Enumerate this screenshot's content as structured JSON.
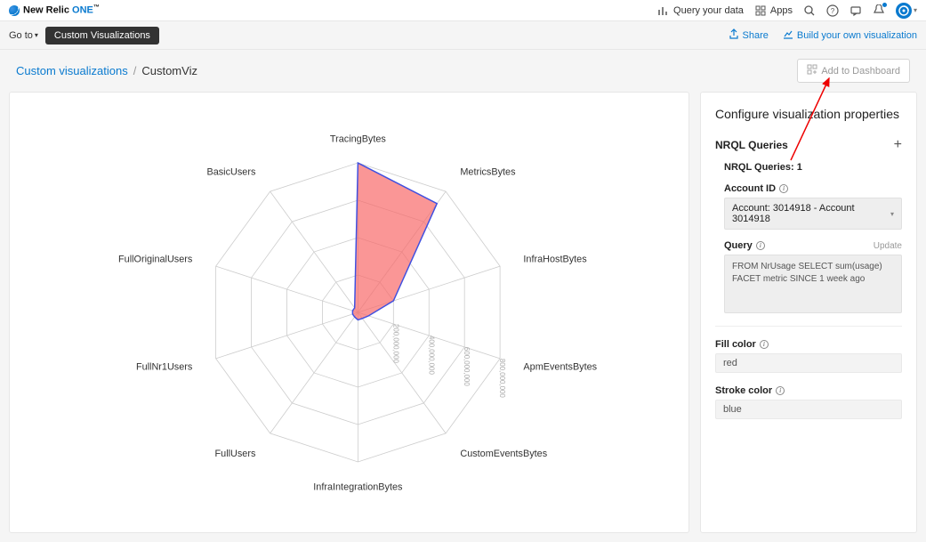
{
  "header": {
    "brand_prefix": "New Relic ",
    "brand_one": "ONE",
    "brand_tm": "™",
    "query_link": "Query your data",
    "apps_link": "Apps"
  },
  "subbar": {
    "goto": "Go to",
    "pill": "Custom Visualizations",
    "share": "Share",
    "build": "Build your own visualization"
  },
  "breadcrumb": {
    "link": "Custom visualizations",
    "sep": "/",
    "current": "CustomViz",
    "add_btn": "Add to Dashboard"
  },
  "config": {
    "title": "Configure visualization properties",
    "nrql_section": "NRQL Queries",
    "nrql_count_label": "NRQL Queries: 1",
    "account_label": "Account ID",
    "account_value": "Account: 3014918 - Account 3014918",
    "query_label": "Query",
    "update": "Update",
    "query_text": "FROM NrUsage SELECT sum(usage) FACET metric SINCE 1 week ago",
    "fill_label": "Fill color",
    "fill_value": "red",
    "stroke_label": "Stroke color",
    "stroke_value": "blue"
  },
  "chart_data": {
    "type": "radar",
    "categories": [
      "TracingBytes",
      "MetricsBytes",
      "InfraHostBytes",
      "ApmEventsBytes",
      "CustomEventsBytes",
      "InfraIntegrationBytes",
      "FullUsers",
      "FullNr1Users",
      "FullOriginalUsers",
      "BasicUsers"
    ],
    "values": [
      800000000,
      720000000,
      200000000,
      60000000,
      40000000,
      40000000,
      30000000,
      30000000,
      30000000,
      30000000
    ],
    "ticks": [
      200000000,
      400000000,
      600000000,
      800000000
    ],
    "tick_labels": [
      "200,000,000",
      "400,000,000",
      "600,000,000",
      "800,000,000"
    ],
    "max": 800000000,
    "fill": "rgba(248,106,106,0.7)",
    "stroke": "#4050e0"
  }
}
